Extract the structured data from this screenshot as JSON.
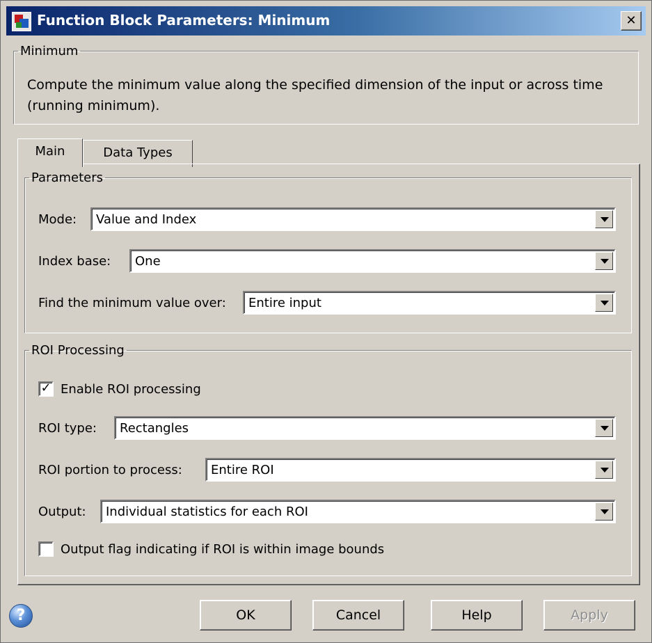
{
  "window": {
    "title": "Function Block Parameters: Minimum",
    "close_glyph": "✕"
  },
  "description_group": {
    "legend": "Minimum",
    "text": "Compute the minimum value along the specified dimension of the input or across time (running minimum)."
  },
  "tabs": [
    {
      "label": "Main",
      "active": true
    },
    {
      "label": "Data Types",
      "active": false
    }
  ],
  "parameters": {
    "legend": "Parameters",
    "mode": {
      "label": "Mode:",
      "value": "Value and Index"
    },
    "index_base": {
      "label": "Index base:",
      "value": "One"
    },
    "find_over": {
      "label": "Find the minimum value over:",
      "value": "Entire input"
    }
  },
  "roi": {
    "legend": "ROI Processing",
    "enable": {
      "label": "Enable ROI processing",
      "checked": true,
      "glyph": "✓"
    },
    "roi_type": {
      "label": "ROI type:",
      "value": "Rectangles"
    },
    "portion": {
      "label": "ROI portion to process:",
      "value": "Entire ROI"
    },
    "output": {
      "label": "Output:",
      "value": "Individual statistics for each ROI"
    },
    "flag": {
      "label": "Output flag indicating if ROI is within image bounds",
      "checked": false
    }
  },
  "buttons": {
    "ok": "OK",
    "cancel": "Cancel",
    "help": "Help",
    "apply": "Apply"
  },
  "help_icon_glyph": "?"
}
